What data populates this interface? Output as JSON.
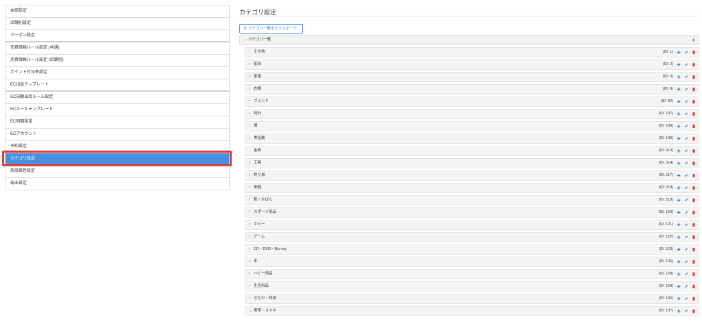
{
  "sidebar": {
    "items": [
      {
        "label": "本部設定"
      },
      {
        "label": "店舗別設定"
      },
      {
        "label": "クーポン設定"
      },
      {
        "label": "売買価格ルール設定 (共通)"
      },
      {
        "label": "売買価格ルール設定 (店舗別)"
      },
      {
        "label": "ポイント付与率設定"
      },
      {
        "label": "EC出品テンプレート"
      },
      {
        "label": "EC自動出品ルール設定"
      },
      {
        "label": "ECメールテンプレート"
      },
      {
        "label": "EC同期設定"
      },
      {
        "label": "ECアカウント"
      },
      {
        "label": "予約設定"
      },
      {
        "label": "カテゴリ設定"
      },
      {
        "label": "商品属性設定"
      },
      {
        "label": "端末設定"
      }
    ]
  },
  "main": {
    "title": "カテゴリ設定",
    "export_label": "カテゴリ一覧をエクスポート",
    "root_label": "カテゴリ一覧",
    "categories": [
      {
        "name": "その他",
        "id": "(ID: 1)",
        "chev": ""
      },
      {
        "name": "家具",
        "id": "(ID: 2)",
        "chev": "›"
      },
      {
        "name": "家電",
        "id": "(ID: 3)",
        "chev": "›"
      },
      {
        "name": "衣類",
        "id": "(ID: 9)",
        "chev": "›"
      },
      {
        "name": "ブランド",
        "id": "(ID: 82)",
        "chev": "›"
      },
      {
        "name": "時計",
        "id": "(ID: 107)",
        "chev": "›"
      },
      {
        "name": "酒",
        "id": "(ID: 108)",
        "chev": "›"
      },
      {
        "name": "貴金属",
        "id": "(ID: 109)",
        "chev": "›"
      },
      {
        "name": "金券",
        "id": "(ID: 113)",
        "chev": ""
      },
      {
        "name": "工具",
        "id": "(ID: 114)",
        "chev": "›"
      },
      {
        "name": "釣り具",
        "id": "(ID: 117)",
        "chev": "›"
      },
      {
        "name": "楽器",
        "id": "(ID: 118)",
        "chev": "›"
      },
      {
        "name": "靴・かばん",
        "id": "(ID: 119)",
        "chev": "›"
      },
      {
        "name": "スポーツ用品",
        "id": "(ID: 120)",
        "chev": "›"
      },
      {
        "name": "ホビー",
        "id": "(ID: 121)",
        "chev": "›"
      },
      {
        "name": "ゲーム",
        "id": "(ID: 122)",
        "chev": "›"
      },
      {
        "name": "CD・DVD・Blu-ray",
        "id": "(ID: 123)",
        "chev": "›"
      },
      {
        "name": "本",
        "id": "(ID: 126)",
        "chev": "›"
      },
      {
        "name": "ベビー用品",
        "id": "(ID: 128)",
        "chev": "›"
      },
      {
        "name": "生活用品",
        "id": "(ID: 129)",
        "chev": "›"
      },
      {
        "name": "きもの・和装",
        "id": "(ID: 136)",
        "chev": "›"
      },
      {
        "name": "携帯・スマホ",
        "id": "(ID: 137)",
        "chev": "⌄"
      }
    ]
  },
  "icons": {
    "add": "plus-icon",
    "edit": "pencil-icon",
    "delete": "trash-icon",
    "download": "download-icon"
  },
  "colors": {
    "accent": "#4a90e2",
    "active_bg": "#4a90e2",
    "delete": "#e53935",
    "highlight": "#e53935"
  }
}
